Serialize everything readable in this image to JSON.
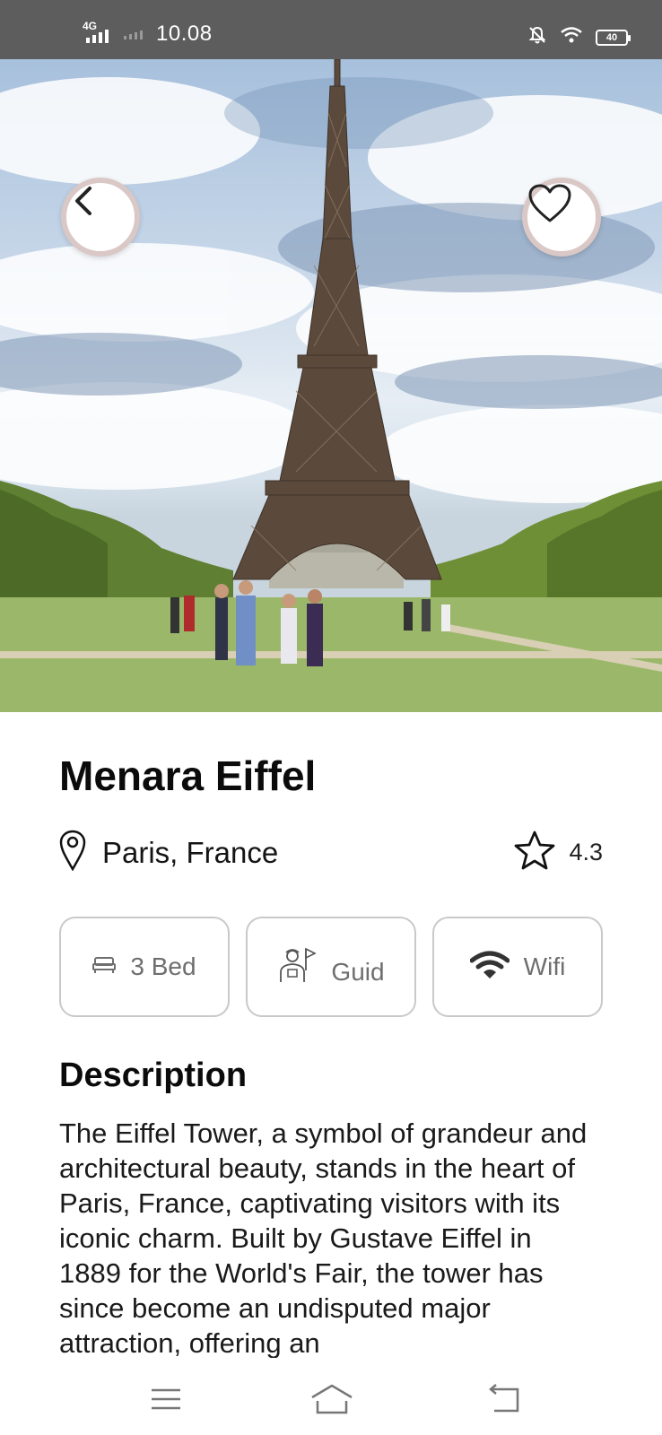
{
  "status_bar": {
    "network": "4G",
    "time": "10.08",
    "battery": "40"
  },
  "hero": {
    "icons": {
      "back": "chevron-left-icon",
      "favorite": "heart-icon"
    }
  },
  "place": {
    "title": "Menara Eiffel",
    "location": "Paris, France",
    "rating": "4.3"
  },
  "features": [
    {
      "label": "3 Bed",
      "icon": "bed-icon"
    },
    {
      "label": "Guid",
      "icon": "guide-icon"
    },
    {
      "label": "Wifi",
      "icon": "wifi-icon"
    }
  ],
  "description": {
    "heading": "Description",
    "text": "The Eiffel Tower, a symbol of grandeur and architectural beauty, stands in the heart of Paris, France, captivating visitors with its iconic charm. Built by Gustave Eiffel in 1889 for the World's Fair, the tower has since become an undisputed major attraction, offering an"
  },
  "nav_bar": {
    "icons": [
      "menu-icon",
      "home-icon",
      "back-icon"
    ]
  },
  "colors": {
    "status_bar_bg": "#5d5d5d",
    "card_border": "#c9c9c9",
    "button_ring": "#d9c8c6"
  }
}
